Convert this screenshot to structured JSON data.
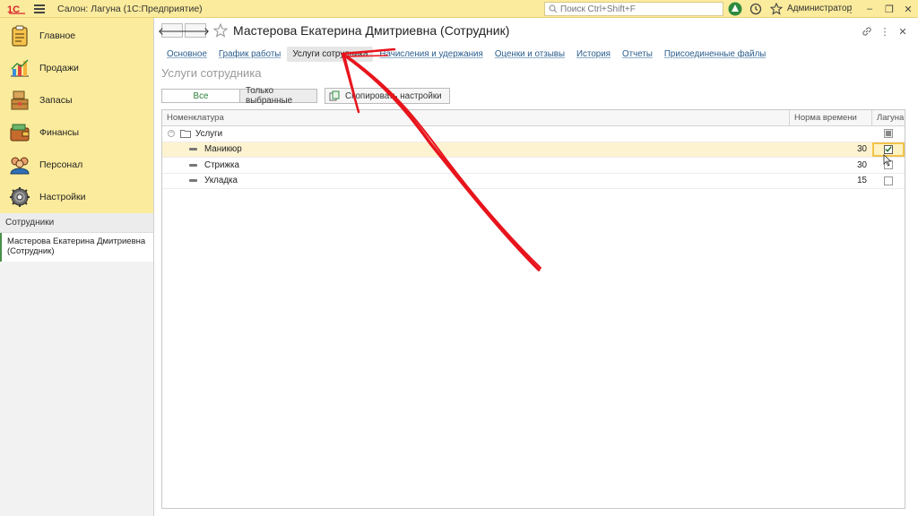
{
  "titlebar": {
    "app_title": "Салон: Лагуна  (1С:Предприятие)",
    "search_placeholder": "Поиск Ctrl+Shift+F",
    "user": "Администратор",
    "logo_icon": "1c-logo-icon",
    "brand_color": "#fbeb9c"
  },
  "sidebar": {
    "sections": [
      {
        "label": "Главное",
        "icon": "clipboard-icon"
      },
      {
        "label": "Продажи",
        "icon": "bar-chart-icon"
      },
      {
        "label": "Запасы",
        "icon": "boxes-icon"
      },
      {
        "label": "Финансы",
        "icon": "wallet-icon"
      },
      {
        "label": "Персонал",
        "icon": "people-icon"
      },
      {
        "label": "Настройки",
        "icon": "gear-icon"
      }
    ],
    "history_title": "Сотрудники",
    "history_item": "Мастерова Екатерина Дмитриевна (Сотрудник)"
  },
  "form": {
    "title": "Мастерова Екатерина Дмитриевна (Сотрудник)",
    "tabs": [
      {
        "label": "Основное",
        "active": false
      },
      {
        "label": "График работы",
        "active": false
      },
      {
        "label": "Услуги сотрудника",
        "active": true
      },
      {
        "label": "Начисления и удержания",
        "active": false
      },
      {
        "label": "Оценки и отзывы",
        "active": false
      },
      {
        "label": "История",
        "active": false
      },
      {
        "label": "Отчеты",
        "active": false
      },
      {
        "label": "Присоединенные файлы",
        "active": false
      }
    ],
    "section_title": "Услуги сотрудника",
    "filter_all": "Все",
    "filter_selected": "Только выбранные",
    "copy_settings": "Скопировать настройки"
  },
  "grid": {
    "columns": [
      "Номенклатура",
      "Норма времени",
      "Лагуна"
    ],
    "group": {
      "name": "Услуги",
      "state": "partial"
    },
    "rows": [
      {
        "name": "Маникюр",
        "time": "30",
        "checked": true
      },
      {
        "name": "Стрижка",
        "time": "30",
        "checked": false
      },
      {
        "name": "Укладка",
        "time": "15",
        "checked": false
      }
    ]
  },
  "annotation": {
    "arrow_color": "#e8141c"
  }
}
